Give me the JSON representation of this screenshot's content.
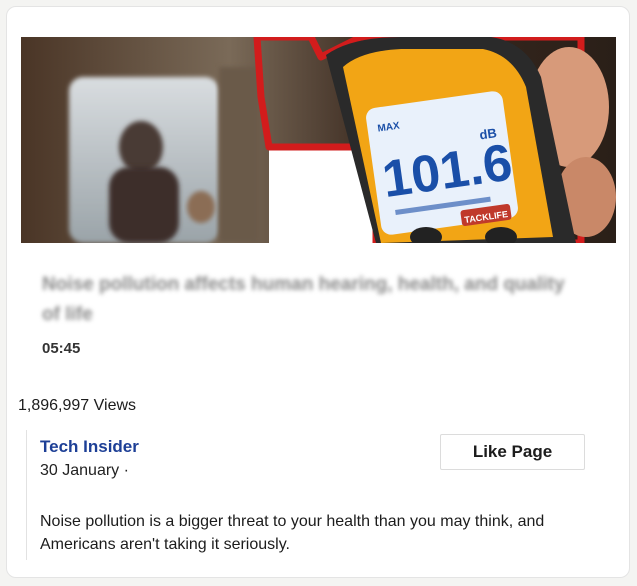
{
  "video": {
    "thumbnail_label": "Noise meter reading 101.6 dB in a subway",
    "meter_reading": "101.6",
    "meter_unit": "dB",
    "meter_brand": "TACKLIFE",
    "title": "Noise pollution affects human hearing, health, and quality of life",
    "duration": "05:45"
  },
  "stats": {
    "views": "1,896,997 Views"
  },
  "post": {
    "page_name": "Tech Insider",
    "date": "30 January ·",
    "like_button_label": "Like Page",
    "body": "Noise pollution is a bigger threat to your health than you may think, and Americans aren't taking it seriously."
  },
  "colors": {
    "page_name": "#1d3f96",
    "meter_body": "#f2a515",
    "meter_screen": "#e9f1fb",
    "meter_digits": "#1a4fa8",
    "outline": "#d21c1c"
  }
}
